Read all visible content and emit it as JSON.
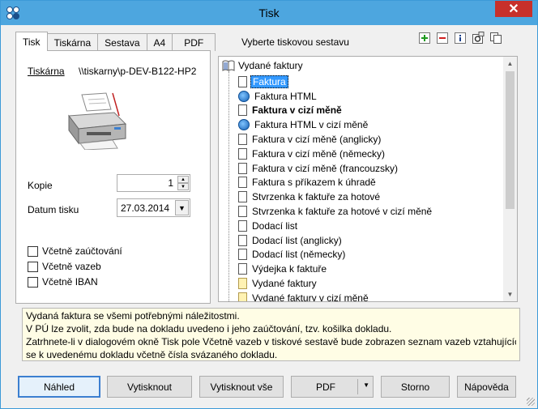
{
  "window": {
    "title": "Tisk",
    "close_glyph": "✕"
  },
  "tabs": [
    {
      "label": "Tisk",
      "active": true
    },
    {
      "label": "Tiskárna",
      "active": false
    },
    {
      "label": "Sestava",
      "active": false
    },
    {
      "label": "A4",
      "active": false
    },
    {
      "label": "PDF",
      "active": false
    }
  ],
  "select_label": "Vyberte tiskovou sestavu",
  "toolbar_icons": [
    "add-icon",
    "remove-icon",
    "info-icon",
    "settings-icon",
    "copy-icon"
  ],
  "printer": {
    "label": "Tiskárna",
    "value": "\\\\tiskarny\\p-DEV-B122-HP2"
  },
  "kopie": {
    "label": "Kopie",
    "value": "1"
  },
  "datum": {
    "label": "Datum tisku",
    "value": "27.03.2014"
  },
  "checkboxes": [
    {
      "label": "Včetně zaúčtování",
      "checked": false
    },
    {
      "label": "Včetně vazeb",
      "checked": false
    },
    {
      "label": "Včetně IBAN",
      "checked": false
    }
  ],
  "tree": {
    "root": "Vydané faktury",
    "items": [
      {
        "label": "Faktura",
        "icon": "doc",
        "bold": false,
        "selected": true
      },
      {
        "label": "Faktura HTML",
        "icon": "html",
        "bold": false,
        "selected": false
      },
      {
        "label": "Faktura v cizí měně",
        "icon": "doc",
        "bold": true,
        "selected": false
      },
      {
        "label": "Faktura HTML v cizí měně",
        "icon": "html",
        "bold": false,
        "selected": false
      },
      {
        "label": "Faktura v cizí měně (anglicky)",
        "icon": "doc",
        "bold": false,
        "selected": false
      },
      {
        "label": "Faktura v cizí měně (německy)",
        "icon": "doc",
        "bold": false,
        "selected": false
      },
      {
        "label": "Faktura v cizí měně (francouzsky)",
        "icon": "doc",
        "bold": false,
        "selected": false
      },
      {
        "label": "Faktura s příkazem k úhradě",
        "icon": "doc",
        "bold": false,
        "selected": false
      },
      {
        "label": "Stvrzenka k faktuře za hotové",
        "icon": "doc",
        "bold": false,
        "selected": false
      },
      {
        "label": "Stvrzenka k faktuře za hotové v cizí měně",
        "icon": "doc",
        "bold": false,
        "selected": false
      },
      {
        "label": "Dodací list",
        "icon": "doc",
        "bold": false,
        "selected": false
      },
      {
        "label": "Dodací list (anglicky)",
        "icon": "doc",
        "bold": false,
        "selected": false
      },
      {
        "label": "Dodací list (německy)",
        "icon": "doc",
        "bold": false,
        "selected": false
      },
      {
        "label": "Výdejka k faktuře",
        "icon": "doc",
        "bold": false,
        "selected": false
      },
      {
        "label": "Vydané faktury",
        "icon": "doc-yellow",
        "bold": false,
        "selected": false
      },
      {
        "label": "Vydané faktury v cizí měně",
        "icon": "doc-yellow",
        "bold": false,
        "selected": false
      }
    ]
  },
  "description": [
    "Vydaná faktura se všemi potřebnými náležitostmi.",
    "V PÚ lze zvolit, zda bude na dokladu uvedeno i jeho zaúčtování, tzv. košilka dokladu.",
    "Zatrhnete-li v dialogovém okně Tisk pole Včetně vazeb v tiskové sestavě bude zobrazen seznam vazeb vztahujících",
    "se k uvedenému dokladu včetně čísla svázaného dokladu."
  ],
  "buttons": {
    "preview": "Náhled",
    "print": "Vytisknout",
    "print_all": "Vytisknout vše",
    "pdf": "PDF",
    "cancel": "Storno",
    "help": "Nápověda"
  },
  "colors": {
    "titlebar": "#4da6df",
    "close": "#c7302b",
    "selection": "#3399ff",
    "description_bg": "#fffde5"
  }
}
